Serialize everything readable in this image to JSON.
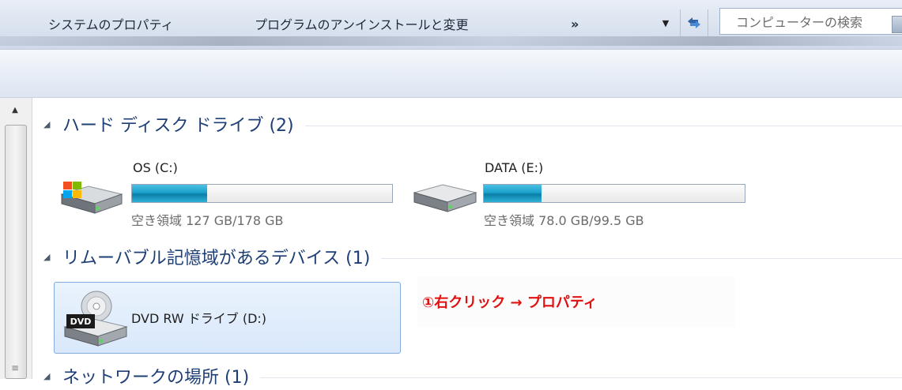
{
  "search": {
    "placeholder": "コンピューターの検索"
  },
  "commandbar": {
    "items": [
      "システムのプロパティ",
      "プログラムのアンインストールと変更"
    ],
    "more": "»"
  },
  "groups": [
    {
      "label": "ハード ディスク ドライブ (2)"
    },
    {
      "label": "リムーバブル記憶域があるデバイス (1)"
    },
    {
      "label": "ネットワークの場所 (1)"
    }
  ],
  "drives": [
    {
      "name": "OS (C:)",
      "space": "空き領域 127 GB/178 GB",
      "used_fraction": 0.29
    },
    {
      "name": "DATA (E:)",
      "space": "空き領域 78.0 GB/99.5 GB",
      "used_fraction": 0.22
    }
  ],
  "dvd": {
    "name": "DVD RW ドライブ (D:)",
    "badge": "DVD"
  },
  "annotation": {
    "text": "①右クリック → プロパティ"
  },
  "colors": {
    "accent_blue": "#1e3f76",
    "bar_fill": "#1aa1cc",
    "annotation_red": "#e01010"
  }
}
